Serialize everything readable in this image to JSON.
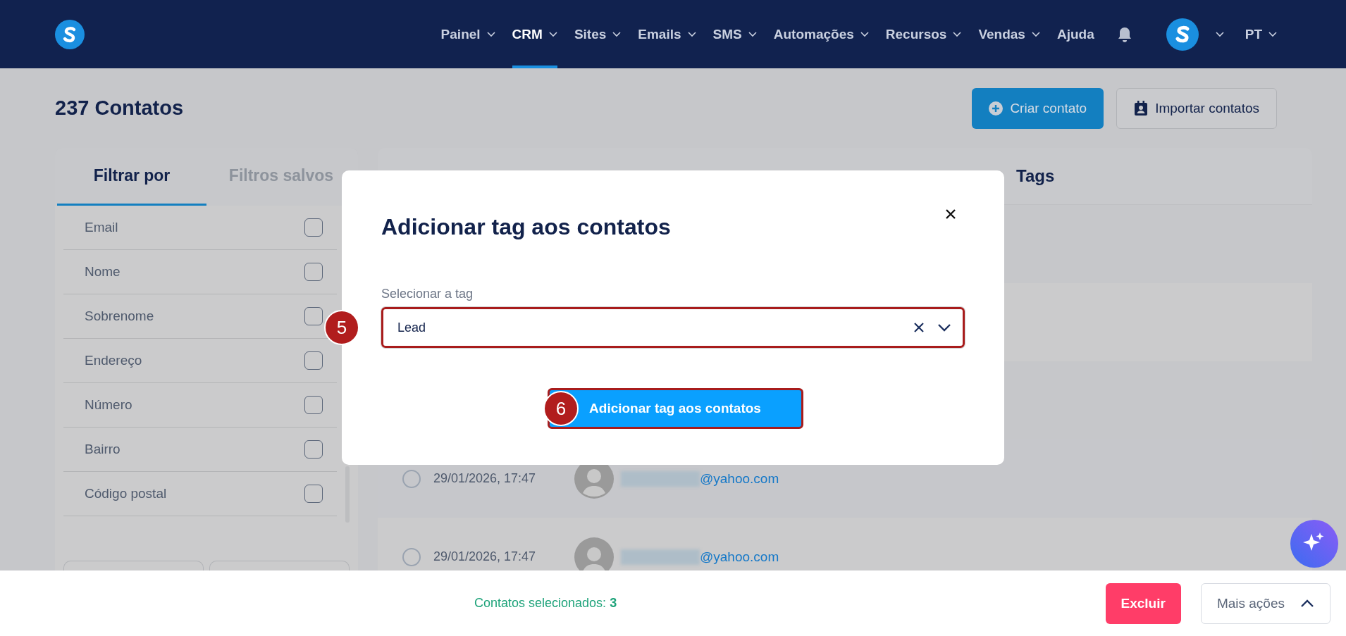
{
  "nav": {
    "items": [
      {
        "label": "Painel",
        "selected": false
      },
      {
        "label": "CRM",
        "selected": true
      },
      {
        "label": "Sites",
        "selected": false
      },
      {
        "label": "Emails",
        "selected": false
      },
      {
        "label": "SMS",
        "selected": false
      },
      {
        "label": "Automações",
        "selected": false
      },
      {
        "label": "Recursos",
        "selected": false
      },
      {
        "label": "Vendas",
        "selected": false
      }
    ],
    "help": "Ajuda",
    "language": "PT"
  },
  "page": {
    "title": "237 Contatos",
    "actions": [
      {
        "label": "Criar contato",
        "kind": "primary"
      },
      {
        "label": "Importar contatos",
        "kind": "secondary"
      }
    ]
  },
  "filters": {
    "tabs": [
      {
        "label": "Filtrar por",
        "selected": true
      },
      {
        "label": "Filtros salvos",
        "selected": false
      }
    ],
    "items": [
      {
        "label": "Email",
        "checked": false
      },
      {
        "label": "Nome",
        "checked": false
      },
      {
        "label": "Sobrenome",
        "checked": false
      },
      {
        "label": "Endereço",
        "checked": false
      },
      {
        "label": "Número",
        "checked": false
      },
      {
        "label": "Bairro",
        "checked": false
      },
      {
        "label": "Código postal",
        "checked": false
      }
    ]
  },
  "table": {
    "columns": [
      {
        "label": "Tags"
      }
    ],
    "rows": [
      {
        "date": "29/01/2026, 17:47",
        "email": "@yahoo.com",
        "selected": false
      },
      {
        "date": "29/01/2026, 17:47",
        "email": "@yahoo.com",
        "selected": false
      }
    ]
  },
  "modal": {
    "title": "Adicionar tag aos contatos",
    "field_label": "Selecionar a tag",
    "value": "Lead",
    "submit": "Adicionar tag aos contatos",
    "field_step": "5",
    "submit_step": "6"
  },
  "selection_bar": {
    "label": "Contatos selecionados:",
    "count": "3",
    "actions": [
      {
        "label": "Excluir",
        "kind": "danger"
      },
      {
        "label": "Mais ações",
        "kind": "menu"
      }
    ]
  }
}
